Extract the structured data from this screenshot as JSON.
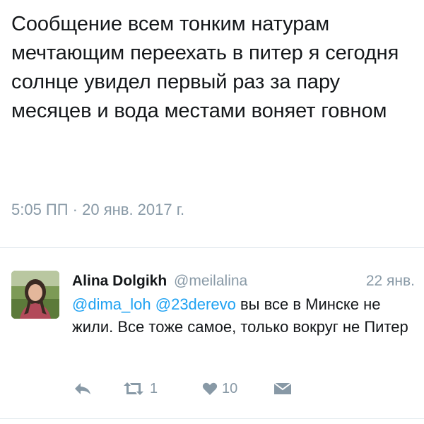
{
  "main_tweet": {
    "text": "Сообщение всем тонким натурам мечтающим переехать в питер я сегодня солнце увидел первый раз за пару месяцев и вода местами воняет говном",
    "meta": "5:05 ПП · 20 янв. 2017 г."
  },
  "reply": {
    "name": "Alina Dolgikh",
    "handle": "@meilalina",
    "date": "22 янв.",
    "mention1": "@dima_loh",
    "mention2": "@23derevo",
    "text": "вы все в Минске не жили. Все тоже самое, только вокруг не Питер",
    "retweet_count": "1",
    "like_count": "10",
    "icons": {
      "reply": "reply-icon",
      "retweet": "retweet-icon",
      "like": "heart-icon",
      "dm": "envelope-icon"
    }
  },
  "colors": {
    "text": "#14171a",
    "muted": "#8899a6",
    "link": "#1da1f2",
    "divider": "#e1e8ed"
  }
}
